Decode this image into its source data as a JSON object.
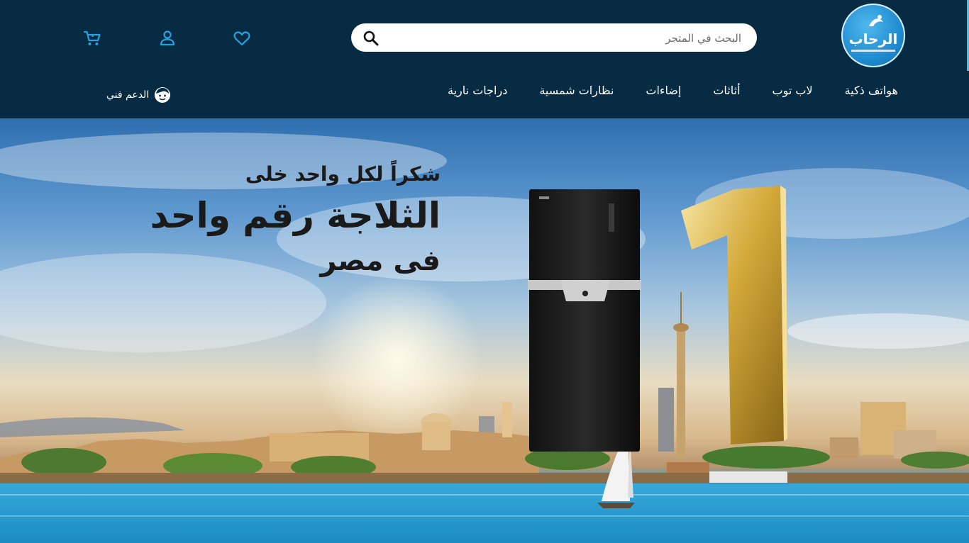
{
  "header": {
    "logo": {
      "text": "الرحاب"
    },
    "search": {
      "placeholder": "البحث في المتجر"
    },
    "icons": {
      "wishlist": "heart-icon",
      "account": "user-icon",
      "cart": "cart-icon",
      "search": "search-icon",
      "support": "support-face-icon"
    },
    "colors": {
      "background": "#062b42",
      "accent": "#29a0e0"
    }
  },
  "nav": {
    "items": [
      {
        "label": "هواتف ذكية"
      },
      {
        "label": "لاب توب"
      },
      {
        "label": "أثاثات"
      },
      {
        "label": "إضاءات"
      },
      {
        "label": "نظارات شمسية"
      },
      {
        "label": "دراجات نارية"
      }
    ],
    "support_label": "الدعم فني"
  },
  "hero": {
    "line1": "شكراً لكل واحد خلى",
    "line2": "الثلاجة رقم واحد",
    "line3": "فى مصر",
    "number": "1"
  }
}
